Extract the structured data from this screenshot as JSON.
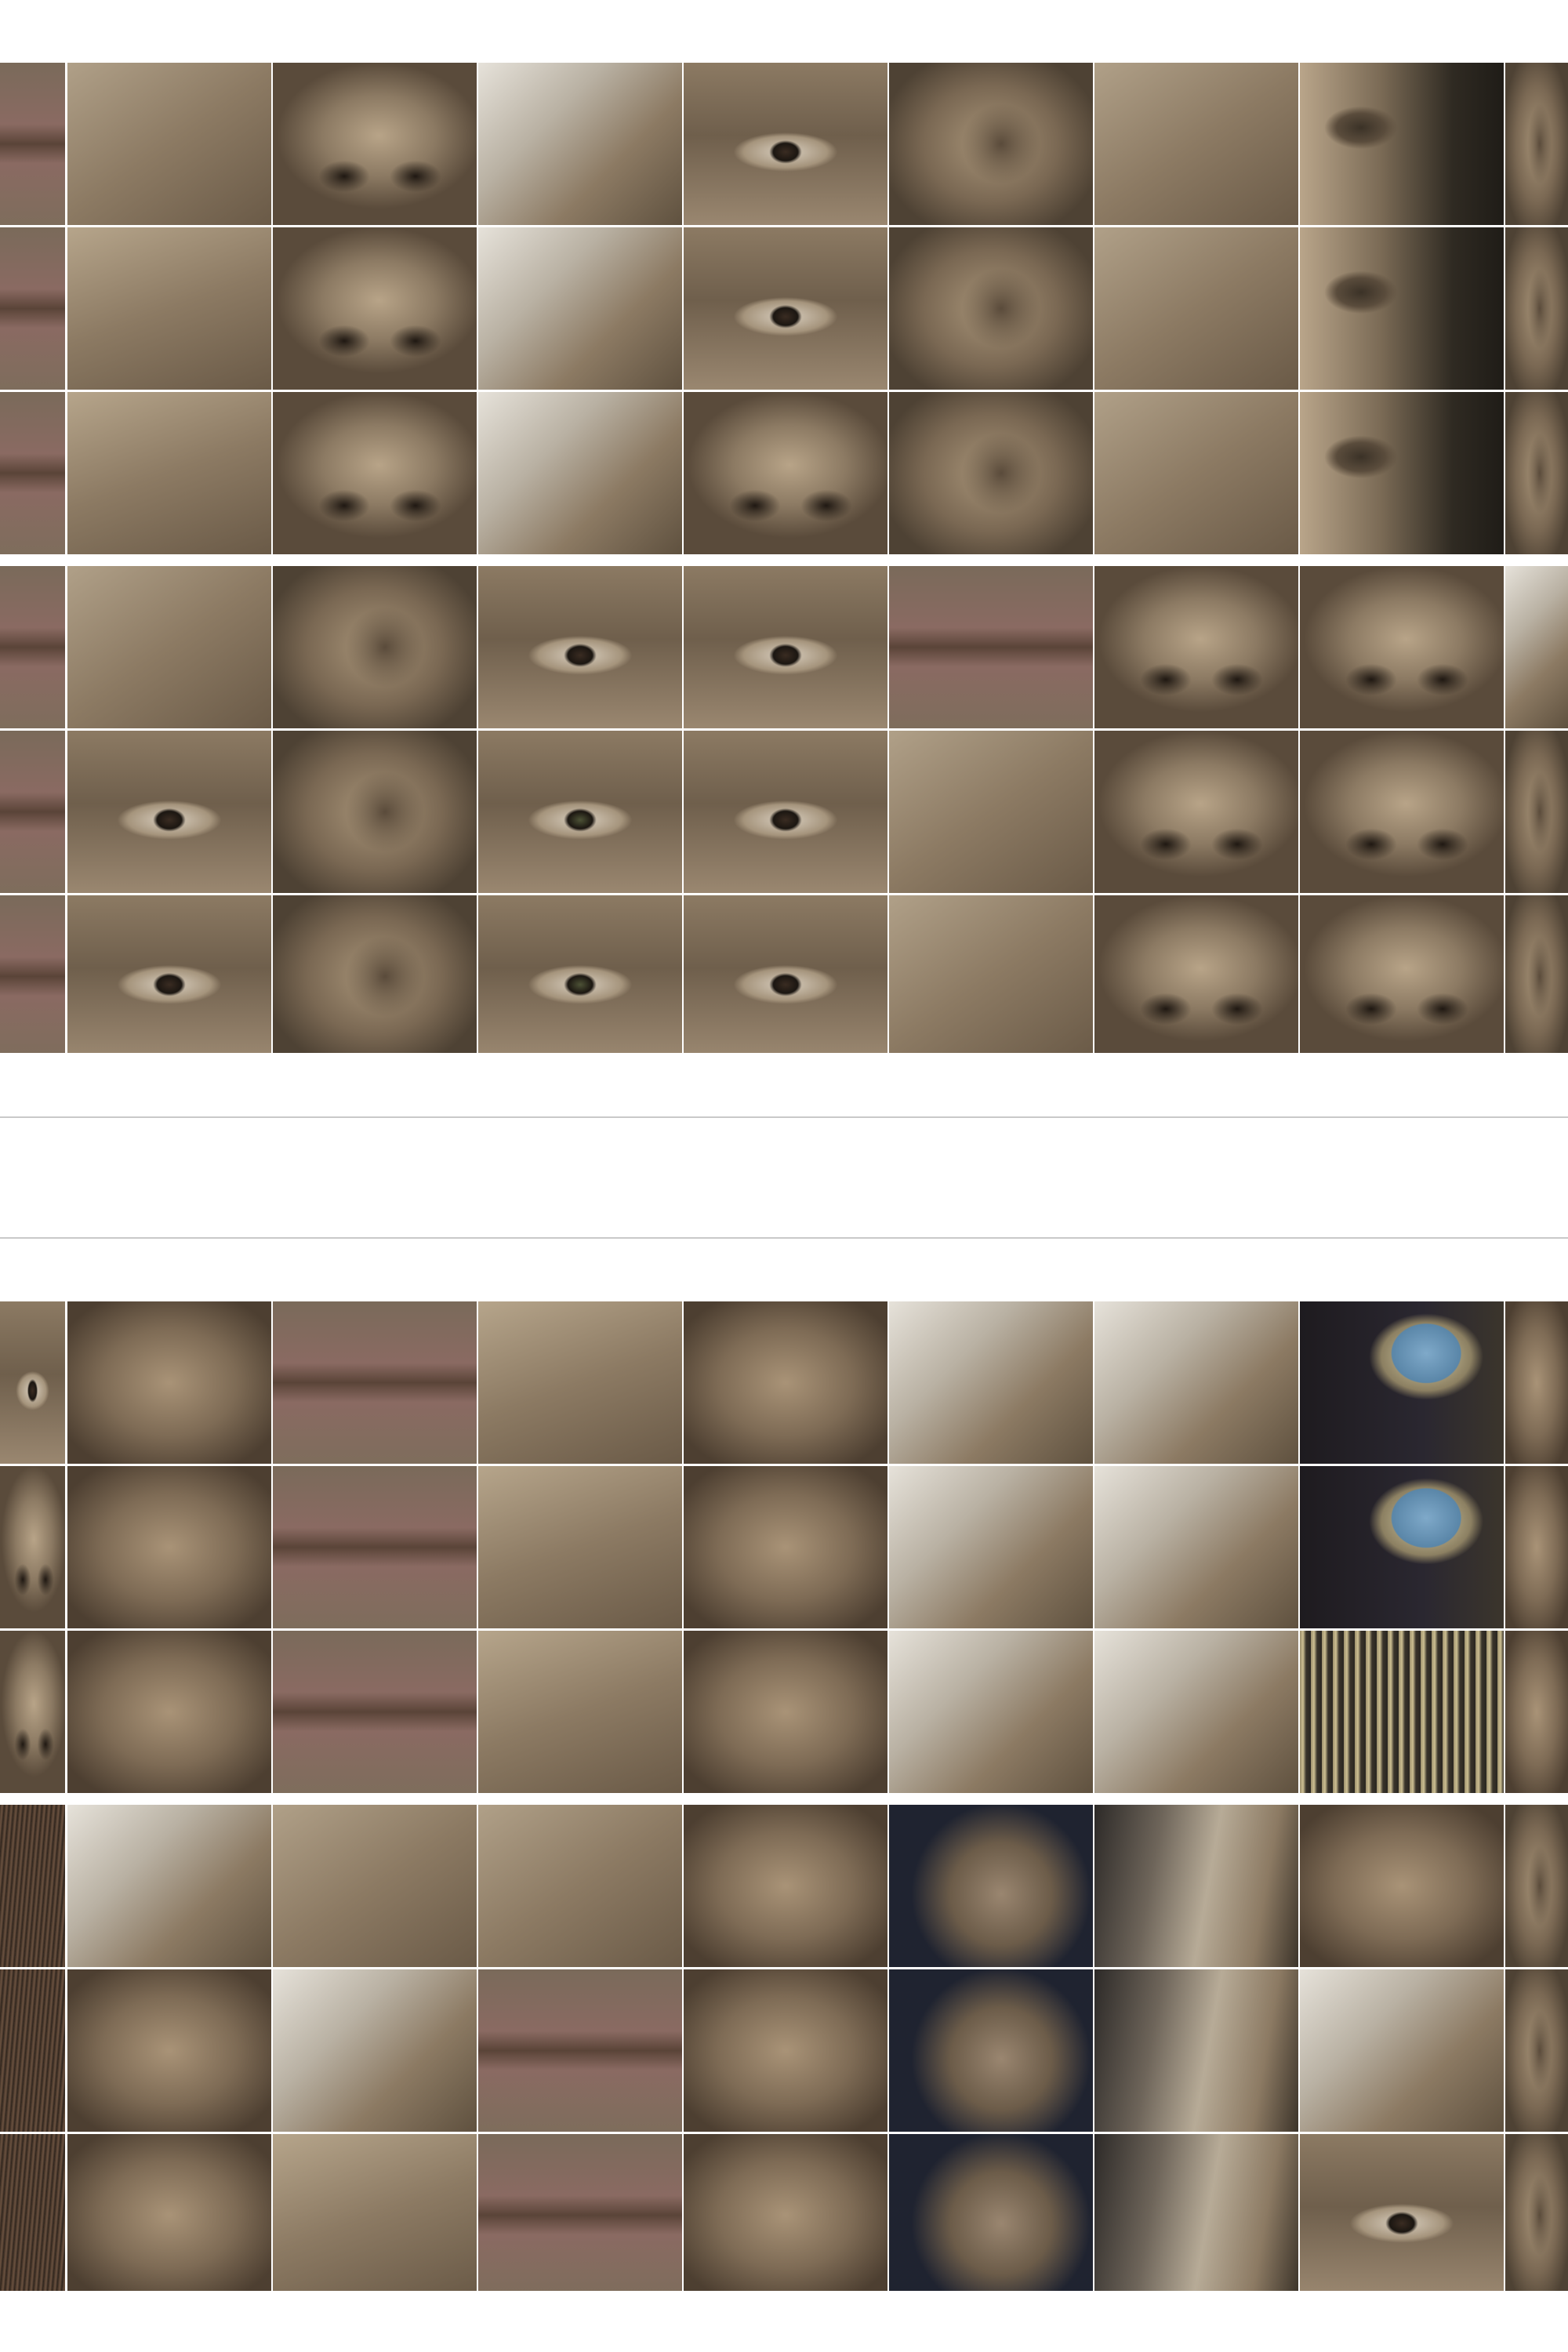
{
  "palette": {
    "background": "#ffffff",
    "gutter": "#ffffff",
    "divider": "#c9c9c9"
  },
  "sections": [
    {
      "name": "top-photo-grid",
      "subjects": [
        [
          "lips",
          "forehead-wrinkles",
          "nose-close",
          "grey-hair",
          "eye-wrinkles",
          "ear-close",
          "cheek-skin",
          "eye-profile-dark",
          "ear-edge"
        ],
        [
          "lips",
          "forehead-hairline",
          "nose-close",
          "grey-hair",
          "eye-close",
          "ear-close",
          "cheek-skin",
          "eye-profile-dark",
          "ear-edge"
        ],
        [
          "lips",
          "hair-strands",
          "nostril",
          "grey-hair",
          "eye-nose",
          "ear-close",
          "cheek-skin",
          "eye-profile-dark",
          "ear-edge"
        ],
        [
          "lips",
          "forehead-skin",
          "ear-fold",
          "eyelid",
          "eyebrow",
          "lip-corner",
          "nostrils",
          "nose-tip",
          "ear-white-hair"
        ],
        [
          "lips",
          "eyebrow",
          "ear-fold",
          "eye-green",
          "eye-wrinkles",
          "cheek-wrinkles",
          "nostrils",
          "nose-tip",
          "ear-fold"
        ],
        [
          "lips",
          "eye-brown",
          "ear-fold",
          "eye-green",
          "eye-blur",
          "cheek-wrinkles",
          "nostrils",
          "nose-tip",
          "ear-fold"
        ]
      ]
    },
    {
      "name": "bottom-photo-grid",
      "subjects": [
        [
          "eye-edge",
          "face-profile",
          "chin-mouth",
          "ear-hair",
          "face-front",
          "ear-hair-white",
          "face-white-hair",
          "earring-blue",
          "face-edge"
        ],
        [
          "nose-edge",
          "face-profile",
          "mouth-wrinkles",
          "ear-hair",
          "face-front",
          "ear-hair-white",
          "face-white-hair",
          "earring-blue",
          "face-edge"
        ],
        [
          "nose-edge",
          "face-profile",
          "nose-mouth",
          "ear-hair",
          "face-front",
          "white-hair",
          "face-white-hair",
          "earring-chain",
          "face-edge"
        ],
        [
          "hair-dark",
          "face-white-hair",
          "chin",
          "cheek-wrinkles",
          "face-profile",
          "face-profile-dark",
          "hair-profile",
          "face-lower",
          "ear-edge"
        ],
        [
          "hair-dark",
          "face-profile",
          "face-white-hair",
          "mouth-wrinkles",
          "face-profile",
          "face-profile-dark",
          "hair-profile",
          "face-white-hair",
          "ear-edge"
        ],
        [
          "hair-dark",
          "face-profile",
          "ear-hair",
          "mouth-wrinkles",
          "face-profile",
          "face-profile-dark",
          "hair-profile",
          "face-eye",
          "ear-edge"
        ]
      ]
    }
  ]
}
